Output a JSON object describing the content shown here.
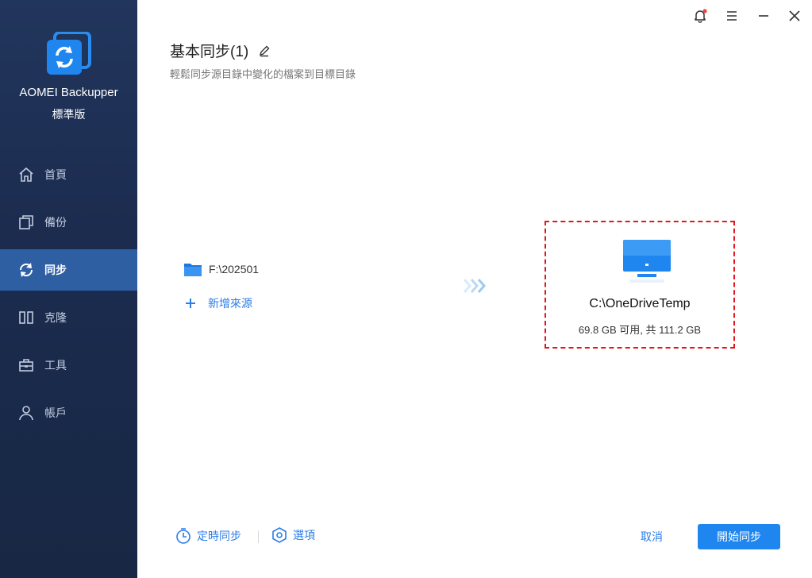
{
  "app": {
    "name": "AOMEI Backupper",
    "edition": "標準版"
  },
  "sidebar": {
    "items": [
      {
        "label": "首頁",
        "icon": "home-icon"
      },
      {
        "label": "備份",
        "icon": "backup-icon"
      },
      {
        "label": "同步",
        "icon": "sync-icon",
        "active": true
      },
      {
        "label": "克隆",
        "icon": "clone-icon"
      },
      {
        "label": "工具",
        "icon": "tools-icon"
      },
      {
        "label": "帳戶",
        "icon": "account-icon"
      }
    ]
  },
  "header": {
    "title": "基本同步(1)",
    "subtitle": "輕鬆同步源目錄中變化的檔案到目標目錄"
  },
  "window_controls": [
    "notification-icon",
    "menu-icon",
    "minimize-icon",
    "close-icon"
  ],
  "source": {
    "path": "F:\\202501",
    "add_label": "新增來源"
  },
  "destination": {
    "path": "C:\\OneDriveTemp",
    "space": "69.8 GB 可用, 共 111.2 GB"
  },
  "footer": {
    "schedule_label": "定時同步",
    "options_label": "選項",
    "cancel_label": "取消",
    "start_label": "開始同步"
  },
  "colors": {
    "accent": "#1f86f0",
    "sidebar_bg": "#1b2c4f",
    "sidebar_active": "#2f5fa3",
    "highlight_border": "#e0161c",
    "notification_dot": "#e84545"
  }
}
